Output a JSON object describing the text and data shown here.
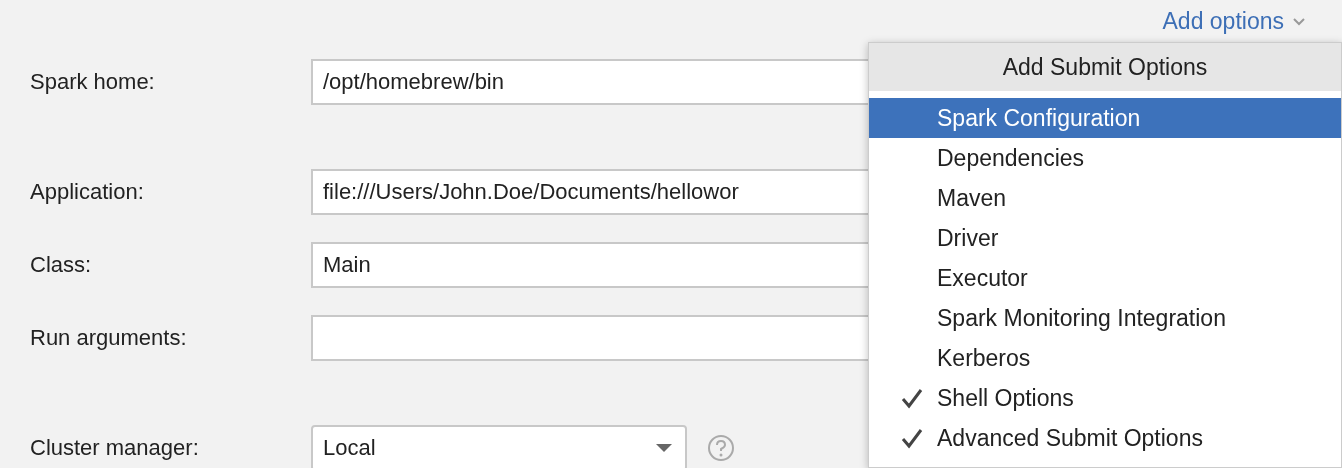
{
  "add_options": {
    "label": "Add options"
  },
  "form": [
    {
      "kind": "text",
      "label": "Spark home:",
      "value": "/opt/homebrew/bin"
    },
    {
      "kind": "text",
      "label": "Application:",
      "value": "file:///Users/John.Doe/Documents/hellowor"
    },
    {
      "kind": "text",
      "label": "Class:",
      "value": "Main"
    },
    {
      "kind": "text",
      "label": "Run arguments:"
    },
    {
      "kind": "select",
      "label": "Cluster manager:",
      "value": "Local"
    }
  ],
  "menu": {
    "title": "Add Submit Options",
    "items": [
      {
        "label": "Spark Configuration",
        "selected": true,
        "checked": false
      },
      {
        "label": "Dependencies",
        "selected": false,
        "checked": false
      },
      {
        "label": "Maven",
        "selected": false,
        "checked": false
      },
      {
        "label": "Driver",
        "selected": false,
        "checked": false
      },
      {
        "label": "Executor",
        "selected": false,
        "checked": false
      },
      {
        "label": "Spark Monitoring Integration",
        "selected": false,
        "checked": false
      },
      {
        "label": "Kerberos",
        "selected": false,
        "checked": false
      },
      {
        "label": "Shell Options",
        "selected": false,
        "checked": true
      },
      {
        "label": "Advanced Submit Options",
        "selected": false,
        "checked": true
      }
    ]
  }
}
